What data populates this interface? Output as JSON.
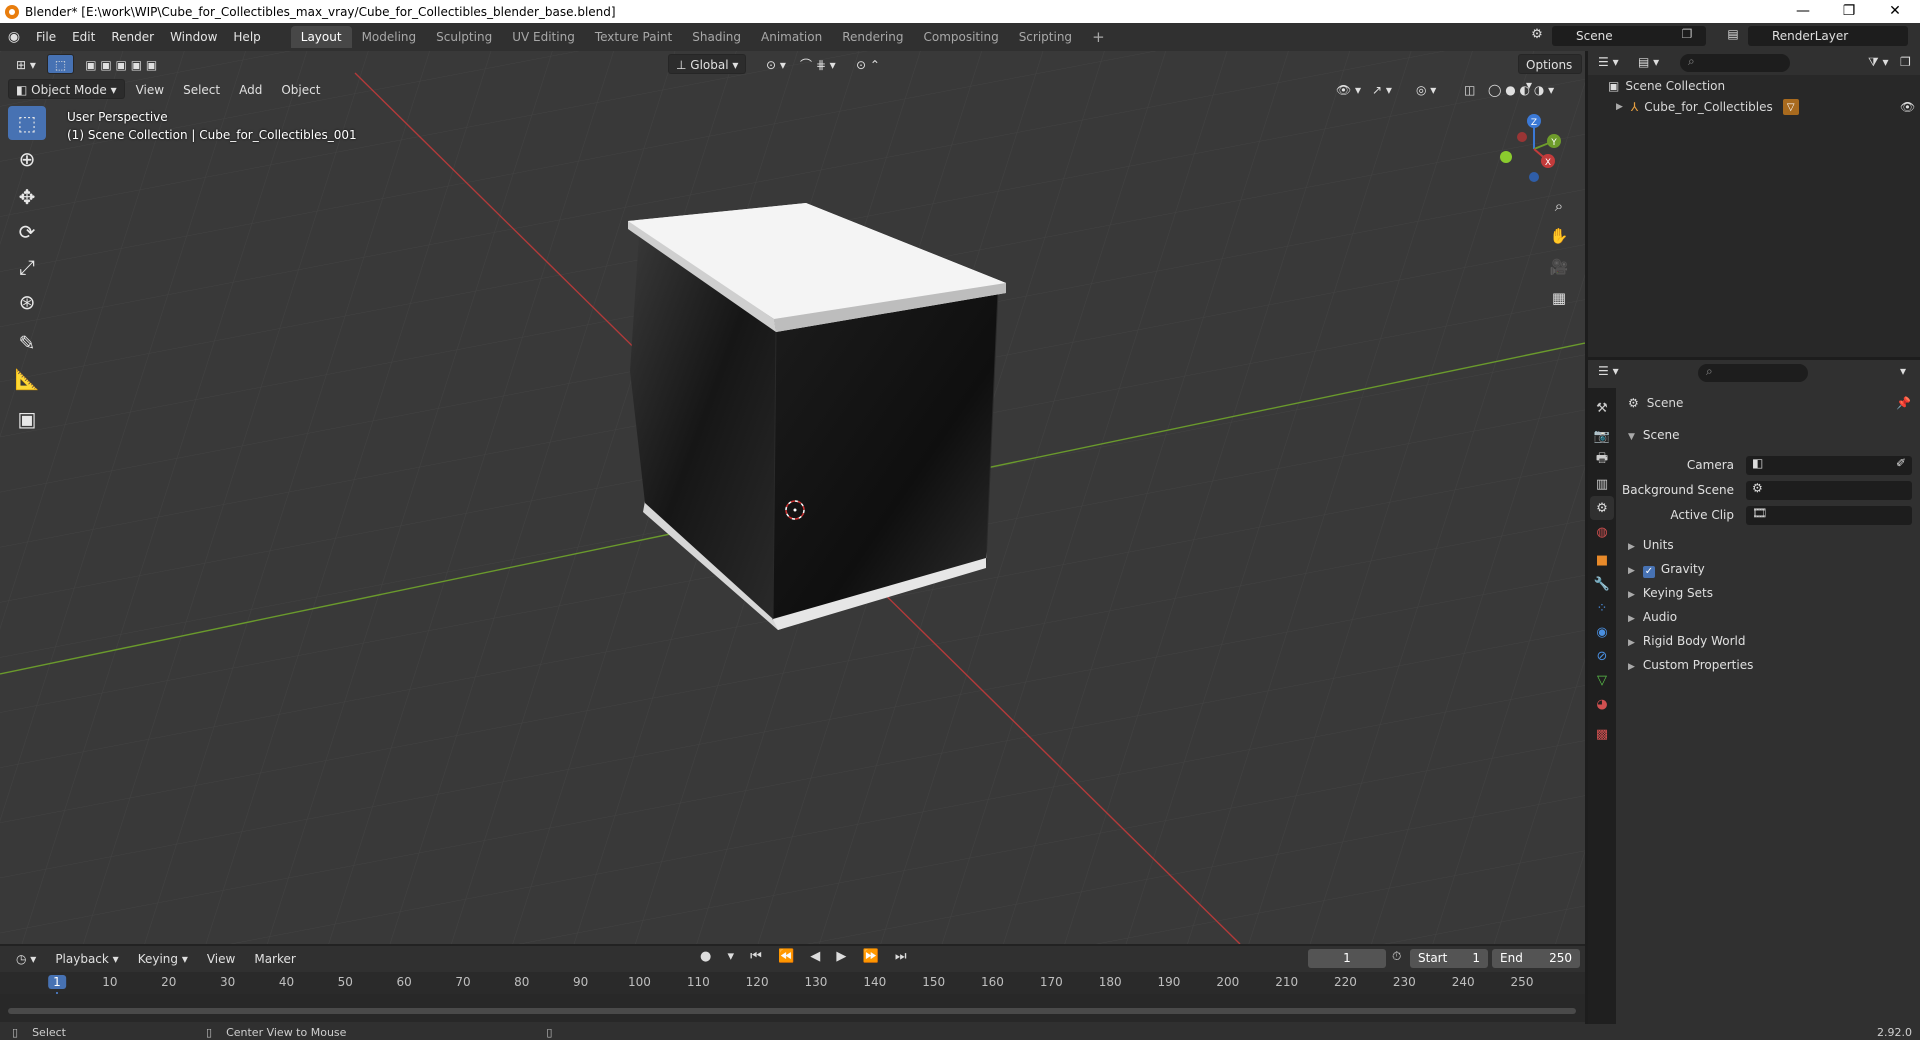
{
  "window": {
    "title": "Blender* [E:\\work\\WIP\\Cube_for_Collectibles_max_vray/Cube_for_Collectibles_blender_base.blend]"
  },
  "menu": [
    "File",
    "Edit",
    "Render",
    "Window",
    "Help"
  ],
  "workspaces": [
    "Layout",
    "Modeling",
    "Sculpting",
    "UV Editing",
    "Texture Paint",
    "Shading",
    "Animation",
    "Rendering",
    "Compositing",
    "Scripting"
  ],
  "scene_name": "Scene",
  "view_layer": "RenderLayer",
  "viewport": {
    "transform_orientation": "Global",
    "options_label": "Options",
    "mode": "Object Mode",
    "header_menus": [
      "View",
      "Select",
      "Add",
      "Object"
    ],
    "perspective_text": "User Perspective",
    "collection_text": "(1) Scene Collection | Cube_for_Collectibles_001",
    "gizmo": {
      "x": "X",
      "y": "Y",
      "z": "Z"
    }
  },
  "outliner": {
    "root": "Scene Collection",
    "items": [
      "Cube_for_Collectibles"
    ]
  },
  "properties": {
    "context_title": "Scene",
    "panel_title": "Scene",
    "fields": [
      "Camera",
      "Background Scene",
      "Active Clip"
    ],
    "subpanels": [
      "Units",
      "Gravity",
      "Keying Sets",
      "Audio",
      "Rigid Body World",
      "Custom Properties"
    ],
    "gravity_checked": true
  },
  "timeline": {
    "menus": [
      "Playback",
      "Keying",
      "View",
      "Marker"
    ],
    "current_frame": "1",
    "start_label": "Start",
    "start": "1",
    "end_label": "End",
    "end": "250",
    "ticks": [
      "1",
      "10",
      "20",
      "30",
      "40",
      "50",
      "60",
      "70",
      "80",
      "90",
      "100",
      "110",
      "120",
      "130",
      "140",
      "150",
      "160",
      "170",
      "180",
      "190",
      "200",
      "210",
      "220",
      "230",
      "240",
      "250"
    ]
  },
  "statusbar": {
    "left": "Select",
    "middle": "Center View to Mouse",
    "version": "2.92.0"
  },
  "colors": {
    "accent": "#4772b3",
    "x_axis": "#c23b3b",
    "y_axis": "#6e9c2b",
    "z_axis": "#3b79d6"
  }
}
